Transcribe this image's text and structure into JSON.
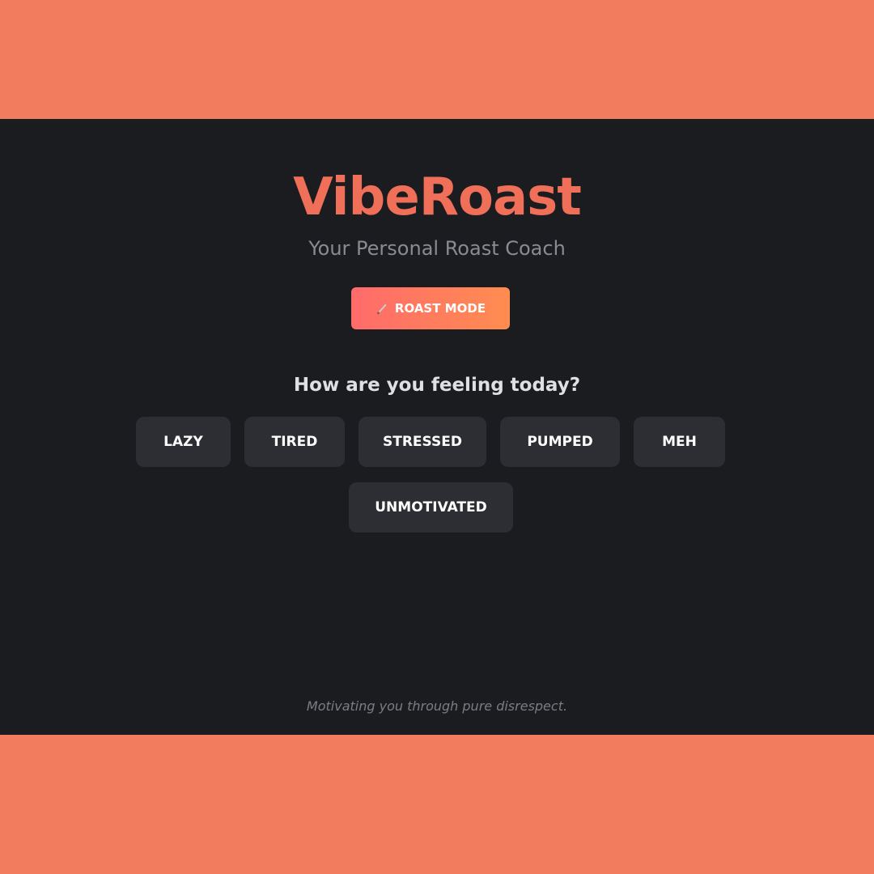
{
  "app": {
    "title": "VibeRoast",
    "subtitle": "Your Personal Roast Coach",
    "mode_button": {
      "label": "ROAST MODE",
      "icon": "knife-icon"
    },
    "question": "How are you feeling today?",
    "moods": [
      {
        "label": "LAZY"
      },
      {
        "label": "TIRED"
      },
      {
        "label": "STRESSED"
      },
      {
        "label": "PUMPED"
      },
      {
        "label": "MEH"
      },
      {
        "label": "UNMOTIVATED"
      }
    ],
    "footer": "Motivating you through pure disrespect."
  },
  "colors": {
    "background_band": "#f27c5e",
    "app_background": "#1b1c20",
    "accent": "#ef6f58",
    "button_gradient_start": "#ff6b6b",
    "button_gradient_end": "#ff8c50",
    "mood_button": "#2d2e33"
  }
}
